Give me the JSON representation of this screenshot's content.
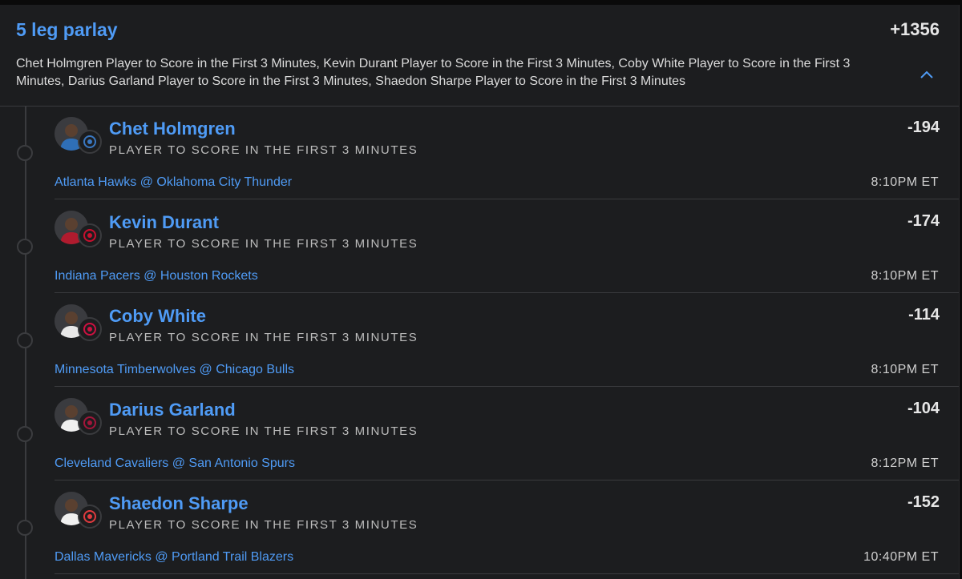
{
  "parlay": {
    "title": "5 leg parlay",
    "odds": "+1356",
    "description": "Chet Holmgren Player to Score in the First 3 Minutes, Kevin Durant Player to Score in the First 3 Minutes, Coby White Player to Score in the First 3 Minutes, Darius Garland Player to Score in the First 3 Minutes, Shaedon Sharpe Player to Score in the First 3 Minutes",
    "collapse_icon": "chevron-up-icon"
  },
  "colors": {
    "accent": "#4f9bf5",
    "background": "#1c1d1f",
    "divider": "#3a3b3e"
  },
  "legs": [
    {
      "player": "Chet Holmgren",
      "market": "PLAYER TO SCORE IN THE FIRST 3 MINUTES",
      "odds": "-194",
      "game": "Atlanta Hawks @ Oklahoma City Thunder",
      "time": "8:10PM ET",
      "jersey_color": "#2f6fb7",
      "team_color": "#3a78c2",
      "team_icon": "thunder-logo-icon"
    },
    {
      "player": "Kevin Durant",
      "market": "PLAYER TO SCORE IN THE FIRST 3 MINUTES",
      "odds": "-174",
      "game": "Indiana Pacers @ Houston Rockets",
      "time": "8:10PM ET",
      "jersey_color": "#b01b2e",
      "team_color": "#c8102e",
      "team_icon": "rockets-logo-icon"
    },
    {
      "player": "Coby White",
      "market": "PLAYER TO SCORE IN THE FIRST 3 MINUTES",
      "odds": "-114",
      "game": "Minnesota Timberwolves @ Chicago Bulls",
      "time": "8:10PM ET",
      "jersey_color": "#e8e8e8",
      "team_color": "#ce1141",
      "team_icon": "bulls-logo-icon"
    },
    {
      "player": "Darius Garland",
      "market": "PLAYER TO SCORE IN THE FIRST 3 MINUTES",
      "odds": "-104",
      "game": "Cleveland Cavaliers @ San Antonio Spurs",
      "time": "8:12PM ET",
      "jersey_color": "#f0f0f0",
      "team_color": "#a3163a",
      "team_icon": "cavaliers-logo-icon"
    },
    {
      "player": "Shaedon Sharpe",
      "market": "PLAYER TO SCORE IN THE FIRST 3 MINUTES",
      "odds": "-152",
      "game": "Dallas Mavericks @ Portland Trail Blazers",
      "time": "10:40PM ET",
      "jersey_color": "#f0f0f0",
      "team_color": "#e03a3e",
      "team_icon": "trail-blazers-logo-icon"
    }
  ]
}
